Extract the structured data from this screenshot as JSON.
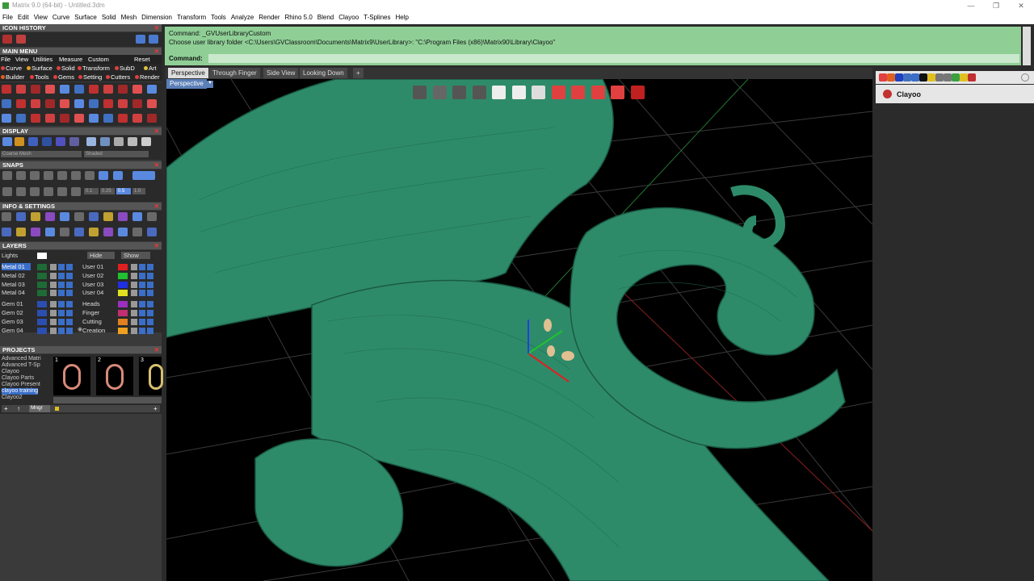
{
  "window": {
    "title": "Matrix 9.0 (64-bit) - Untitled.3dm",
    "controls": [
      "—",
      "❐",
      "✕"
    ]
  },
  "menubar": {
    "items": [
      "File",
      "Edit",
      "View",
      "Curve",
      "Surface",
      "Solid",
      "Mesh",
      "Dimension",
      "Transform",
      "Tools",
      "Analyze",
      "Render",
      "Rhino 5.0",
      "Blend",
      "Clayoo",
      "T-Splines",
      "Help"
    ]
  },
  "left": {
    "icon_history": "ICON HISTORY",
    "main_menu": "MAIN MENU",
    "main_menu_items": [
      "File",
      "View",
      "Utilities",
      "Measure",
      "Custom",
      "Reset"
    ],
    "sub_row1": [
      "Curve",
      "Surface",
      "Solid",
      "Transform",
      "SubD",
      "Art"
    ],
    "sub_row2": [
      "Builder",
      "Tools",
      "Gems",
      "Setting",
      "Cutters",
      "Render"
    ],
    "display": "DISPLAY",
    "display_dropdowns": [
      "Coarse Mesh",
      "Shaded"
    ],
    "snaps": "SNAPS",
    "snap_values": [
      "0.1",
      "0.25",
      "0.5",
      "1.0"
    ],
    "info_settings": "INFO & SETTINGS",
    "layers": "LAYERS",
    "lights": "Lights",
    "hide": "Hide",
    "show": "Show",
    "layers_left": [
      "Metal 01",
      "Metal 02",
      "Metal 03",
      "Metal 04",
      "Gem 01",
      "Gem 02",
      "Gem 03",
      "Gem 04"
    ],
    "layers_right": [
      "User 01",
      "User 02",
      "User 03",
      "User 04",
      "Heads",
      "Finger",
      "Cutting",
      "Creation"
    ],
    "layer_colors_left": [
      "#1e6b35",
      "#1e6b35",
      "#1e6b35",
      "#1e6b35",
      "#2b4fb0",
      "#2b4fb0",
      "#2b4fb0",
      "#2b4fb0"
    ],
    "layer_colors_right": [
      "#e02020",
      "#20c030",
      "#2030e0",
      "#e0e020",
      "#9b30c0",
      "#c03070",
      "#e08020",
      "#f0a020"
    ],
    "projects": "PROJECTS",
    "project_list": [
      "Advanced Matri",
      "Advanced T-Sp",
      "Clayoo",
      "Clayoo Parts",
      "Clayoo Present",
      "clayoo training",
      "Clayoo2"
    ],
    "project_nums": [
      "1",
      "2",
      "3"
    ],
    "mngr": "Mngr"
  },
  "command": {
    "line1": "Command: _GVUserLibraryCustom",
    "line2": "Choose user library folder <C:\\Users\\GVClassroom\\Documents\\Matrix9\\UserLibrary>:  \"C:\\Program Files (x86)\\Matrix90\\Library\\Clayoo\"",
    "prompt": "Command:"
  },
  "tabs": [
    "Perspective",
    "Through Finger",
    "Side View",
    "Looking Down",
    "+"
  ],
  "viewport": {
    "label": "Perspective",
    "background": "#000000",
    "model_color": "#2e8b6a"
  },
  "right": {
    "panel_title": "Clayoo"
  }
}
